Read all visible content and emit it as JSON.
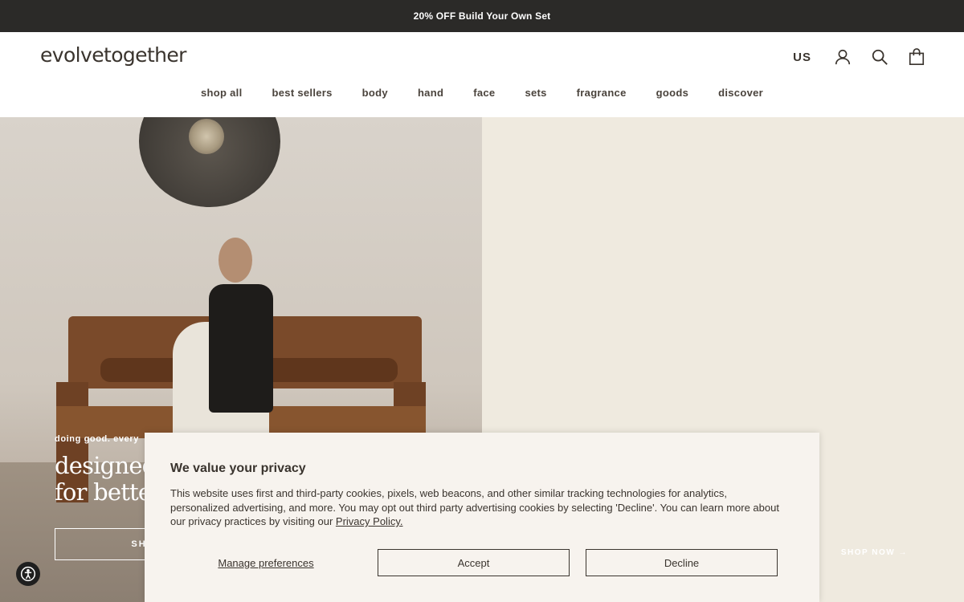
{
  "announcement": {
    "text": "20% OFF Build Your Own Set"
  },
  "header": {
    "logo": "evolvetogether",
    "country": "US",
    "icons": {
      "account": "account-icon",
      "search": "search-icon",
      "cart": "cart-icon"
    }
  },
  "nav": {
    "items": [
      {
        "label": "shop all"
      },
      {
        "label": "best sellers"
      },
      {
        "label": "body"
      },
      {
        "label": "hand"
      },
      {
        "label": "face"
      },
      {
        "label": "sets"
      },
      {
        "label": "fragrance"
      },
      {
        "label": "goods"
      },
      {
        "label": "discover"
      }
    ]
  },
  "hero": {
    "kicker": "doing good. every",
    "title_line1": "designed",
    "title_line2": "for better",
    "button_label": "SH",
    "right_link": "SHOP NOW →"
  },
  "cookie": {
    "title": "We value your privacy",
    "body": "This website uses first and third-party cookies, pixels, web beacons, and other similar tracking technologies for analytics, personalized advertising, and more. You may opt out third party advertising cookies by selecting 'Decline'. You can learn more about our privacy practices by visiting our ",
    "privacy_link": "Privacy Policy.",
    "manage_label": "Manage preferences",
    "accept_label": "Accept",
    "decline_label": "Decline"
  },
  "colors": {
    "announcement_bg": "#2b2a28",
    "text": "#3a342e",
    "hero_right_bg": "#efeadf",
    "cookie_bg": "#f7f3ee"
  }
}
